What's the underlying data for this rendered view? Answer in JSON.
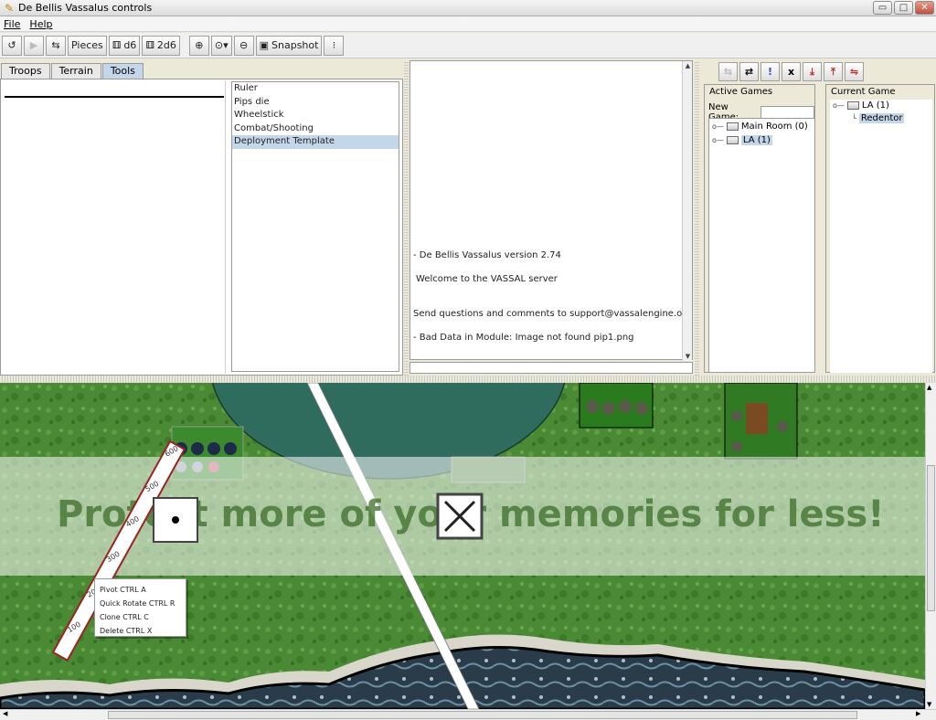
{
  "window": {
    "title": "De Bellis Vassalus controls",
    "app_icon": "vassal-icon",
    "buttons": [
      "minimize",
      "maximize",
      "close"
    ]
  },
  "menu": {
    "items": [
      "File",
      "Help"
    ]
  },
  "toolbar": {
    "pieces_label": "Pieces",
    "d6_label": "d6",
    "twod6_label": "2d6",
    "snapshot_label": "Snapshot"
  },
  "left_tabs": {
    "tabs": [
      "Troops",
      "Terrain",
      "Tools"
    ],
    "active": "Tools"
  },
  "tools_list": {
    "items": [
      "Ruler",
      "Pips die",
      "Wheelstick",
      "Combat/Shooting",
      "Deployment Template"
    ],
    "selected": "Deployment Template"
  },
  "chat": {
    "lines": [
      "- De Bellis Vassalus version 2.74",
      "Welcome to the VASSAL server",
      "Send questions and comments to support@vassalengine.org",
      "- Bad Data in Module: Image not found pip1.png"
    ]
  },
  "server": {
    "active_games_title": "Active Games",
    "new_game_label": "New Game:",
    "rooms": [
      "Main Room (0)",
      "LA (1)"
    ],
    "current_game_title": "Current Game",
    "current_room": "LA (1)",
    "current_player": "Redentor"
  },
  "context_menu": {
    "items": [
      "Pivot    CTRL A",
      "Quick Rotate   CTRL R",
      "Clone   CTRL C",
      "Delete   CTRL X"
    ]
  },
  "map": {
    "ruler_marks": [
      "600",
      "500",
      "400",
      "300",
      "200",
      "100"
    ],
    "watermark": "Protect more of your memories for less!"
  },
  "colors": {
    "tab_active": "#c4d7ea",
    "grass": "#3f7d2c",
    "water": "#2a3c4a"
  }
}
